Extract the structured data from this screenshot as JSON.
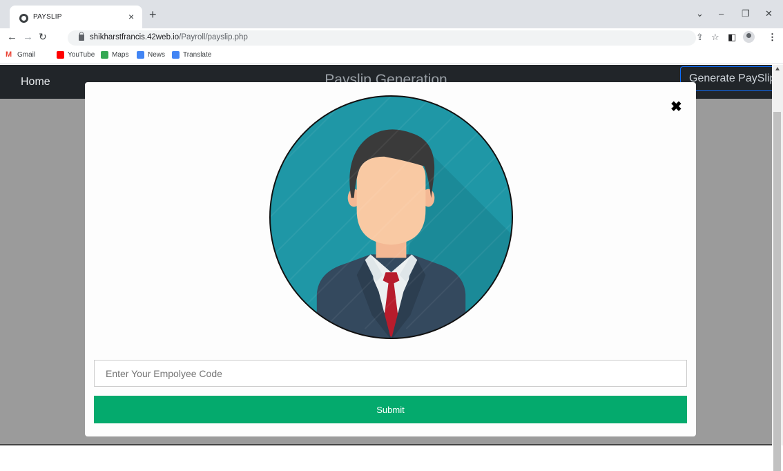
{
  "browser": {
    "tab_title": "PAYSLIP",
    "tab_close": "×",
    "new_tab": "+",
    "url_host": "shikharstfrancis.42web.io",
    "url_path": "/Payroll/payslip.php",
    "bookmarks": [
      {
        "label": "Gmail",
        "color": "#ea4335"
      },
      {
        "label": "YouTube",
        "color": "#ff0000"
      },
      {
        "label": "Maps",
        "color": "#34a853"
      },
      {
        "label": "News",
        "color": "#4285f4"
      },
      {
        "label": "Translate",
        "color": "#4285f4"
      }
    ]
  },
  "navbar": {
    "home_label": "Home",
    "title": "Payslip Generation",
    "generate_label": "Generate PaySlip"
  },
  "modal": {
    "close_symbol": "✖",
    "input_placeholder": "Enter Your Empolyee Code",
    "submit_label": "Submit"
  },
  "colors": {
    "navbar": "#212529",
    "submit": "#04aa6d",
    "avatar_bg": "#1f97a6",
    "suit": "#34495e",
    "tie": "#b71c2c"
  }
}
